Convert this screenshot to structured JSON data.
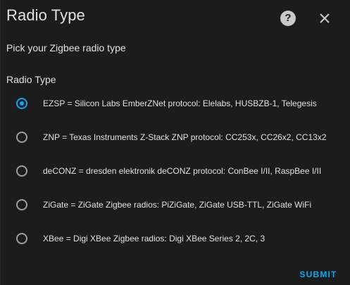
{
  "dialog": {
    "title": "Radio Type",
    "help_icon": "help-circle-icon",
    "close_icon": "close-icon",
    "subtitle": "Pick your Zigbee radio type",
    "group_label": "Radio Type",
    "options": [
      {
        "label": "EZSP = Silicon Labs EmberZNet protocol: Elelabs, HUSBZB-1, Telegesis",
        "selected": true
      },
      {
        "label": "ZNP = Texas Instruments Z-Stack ZNP protocol: CC253x, CC26x2, CC13x2",
        "selected": false
      },
      {
        "label": "deCONZ = dresden elektronik deCONZ protocol: ConBee I/II, RaspBee I/II",
        "selected": false
      },
      {
        "label": "ZiGate = ZiGate Zigbee radios: PiZiGate, ZiGate USB-TTL, ZiGate WiFi",
        "selected": false
      },
      {
        "label": "XBee = Digi XBee Zigbee radios: Digi XBee Series 2, 2C, 3",
        "selected": false
      }
    ],
    "submit_label": "SUBMIT"
  },
  "colors": {
    "background": "#1c1c1c",
    "text": "#e1e1e1",
    "accent": "#03a9f4",
    "radio_unchecked": "#9e9e9e"
  }
}
